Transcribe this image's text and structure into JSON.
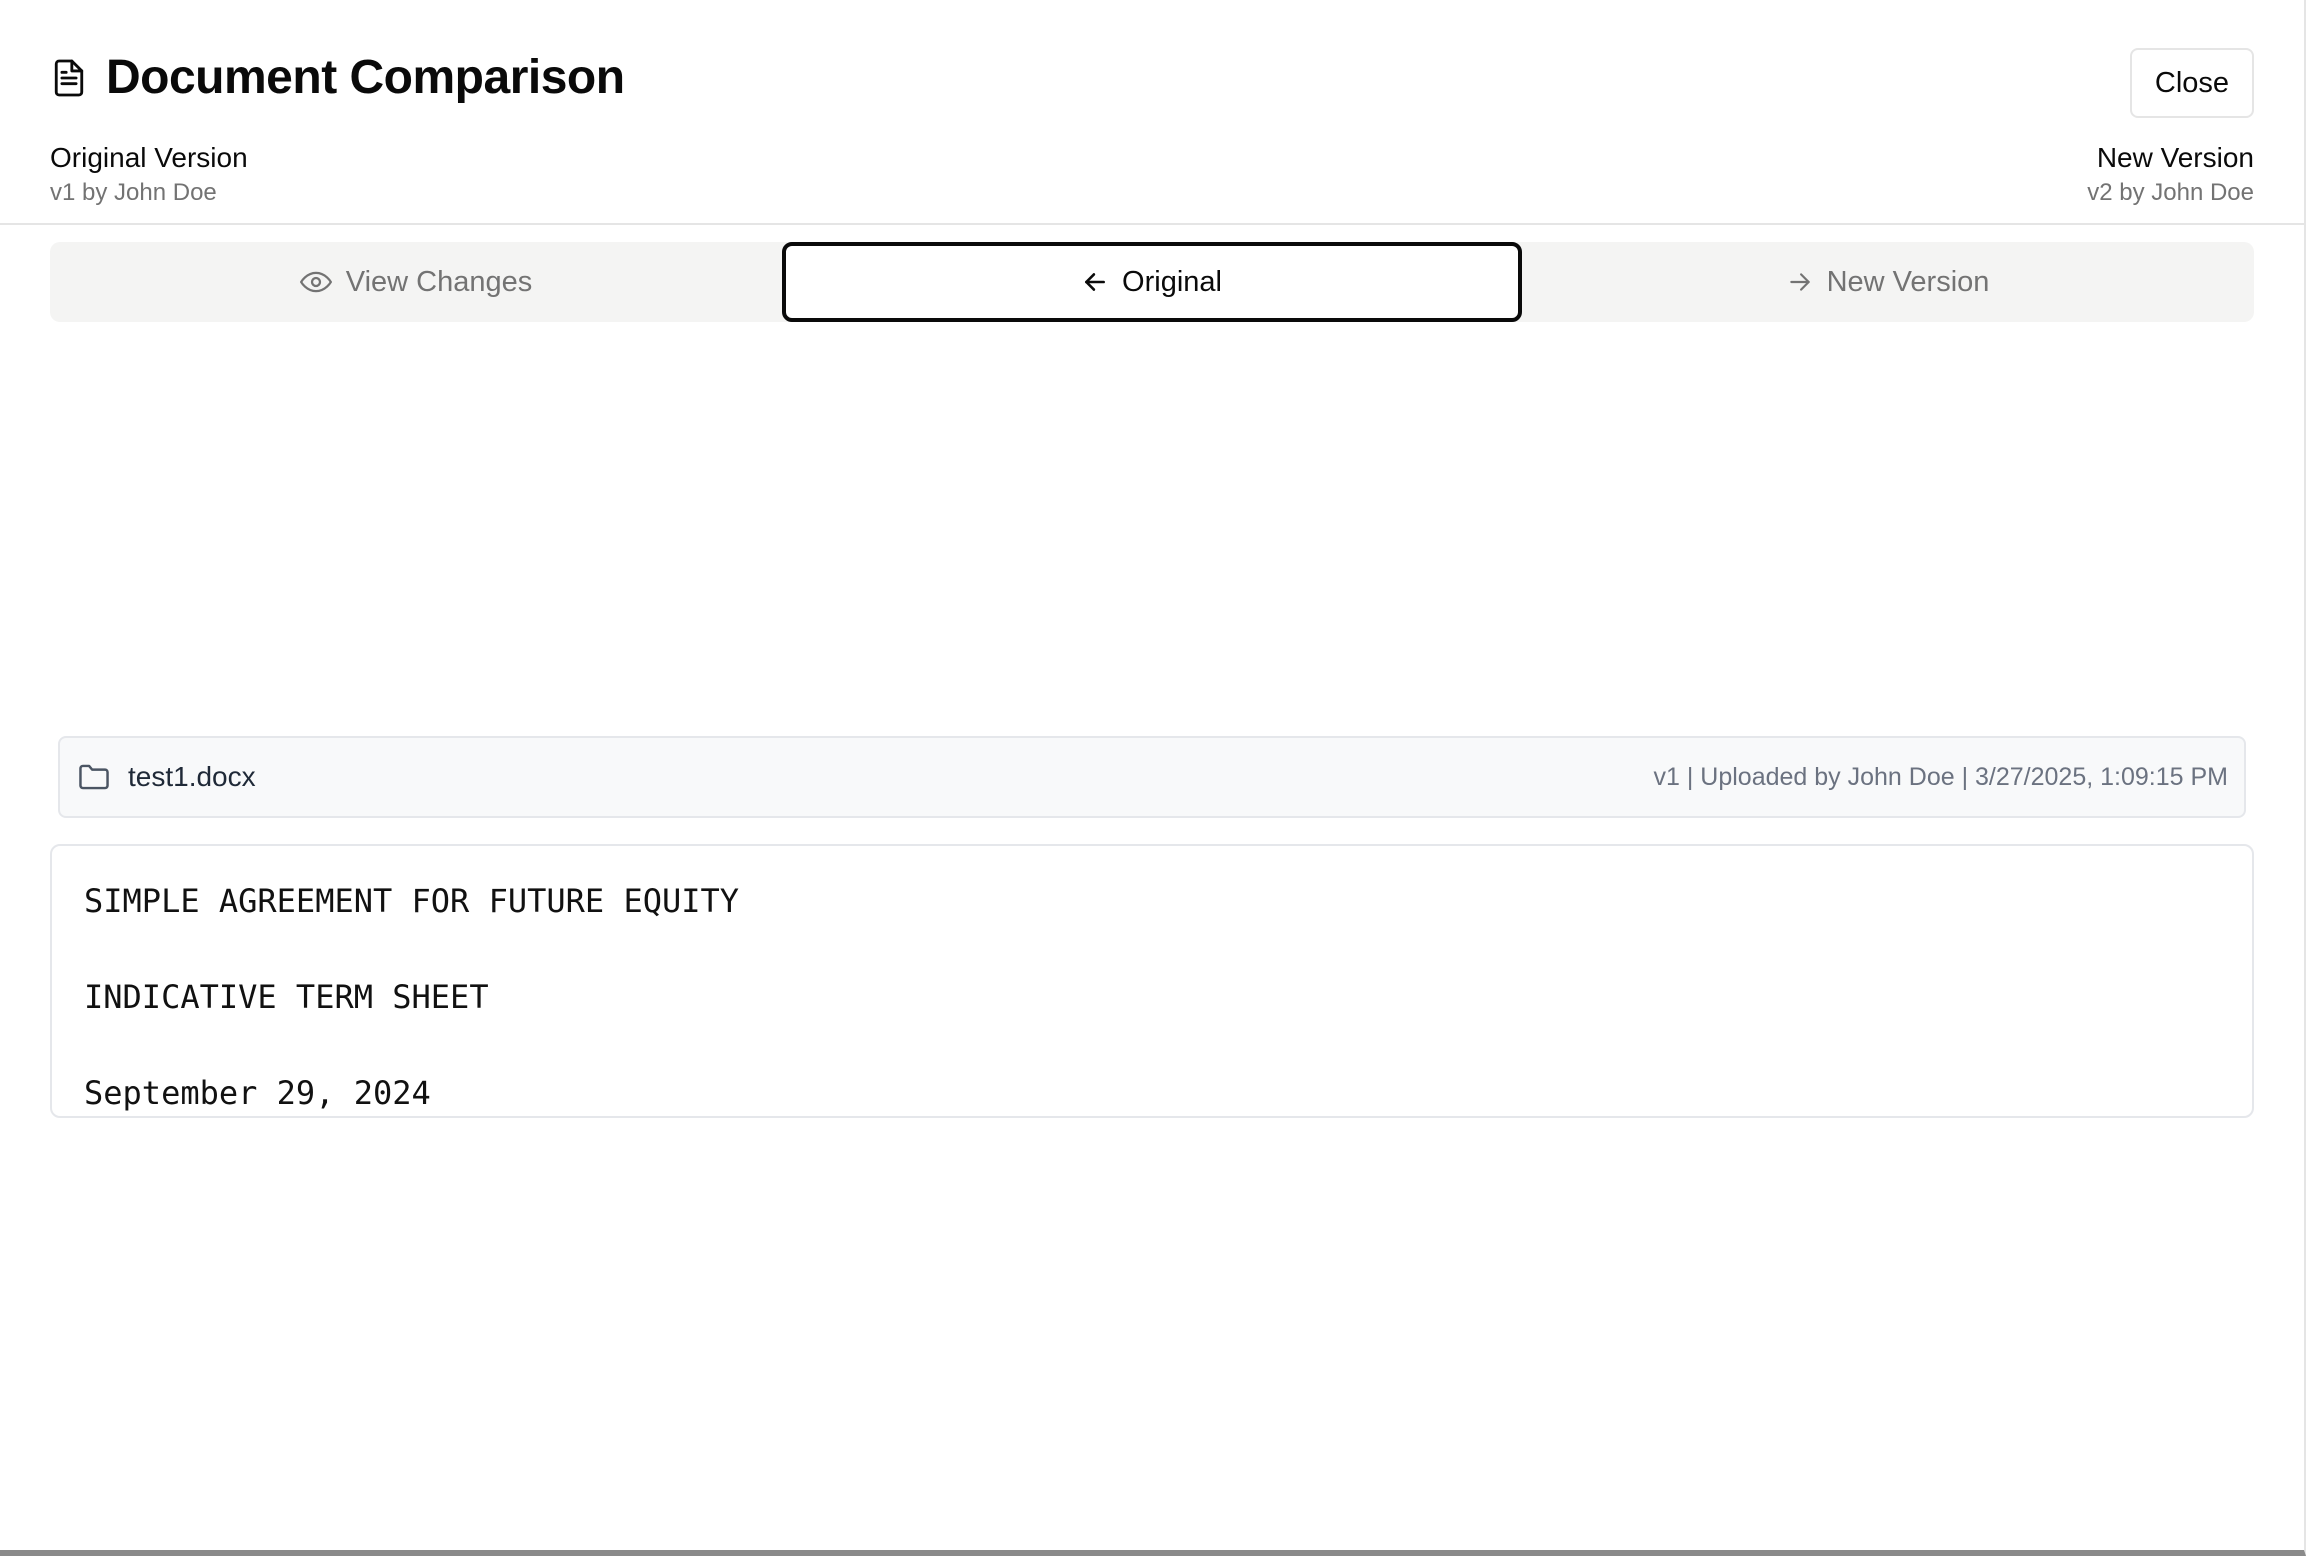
{
  "dialog": {
    "title": "Document Comparison",
    "title_icon": "file-text-icon",
    "close_label": "Close"
  },
  "versions": {
    "original": {
      "label": "Original Version",
      "sub": "v1 by John Doe"
    },
    "new": {
      "label": "New Version",
      "sub": "v2 by John Doe"
    }
  },
  "tabs": [
    {
      "label": "View Changes",
      "icon": "eye-icon",
      "active": false
    },
    {
      "label": "Original",
      "icon": "arrow-left-icon",
      "active": true
    },
    {
      "label": "New Version",
      "icon": "arrow-right-icon",
      "active": false
    }
  ],
  "file": {
    "icon": "folder-icon",
    "name": "test1.docx",
    "meta": "v1 | Uploaded by John Doe | 3/27/2025, 1:09:15 PM"
  },
  "document": {
    "lines": [
      "SIMPLE AGREEMENT FOR FUTURE EQUITY",
      "INDICATIVE TERM SHEET",
      "September 29, 2024"
    ]
  },
  "colors": {
    "text": "#0a0a0a",
    "muted": "#737373",
    "tabs_bg": "#f4f4f3",
    "border": "#e5e5e5"
  }
}
